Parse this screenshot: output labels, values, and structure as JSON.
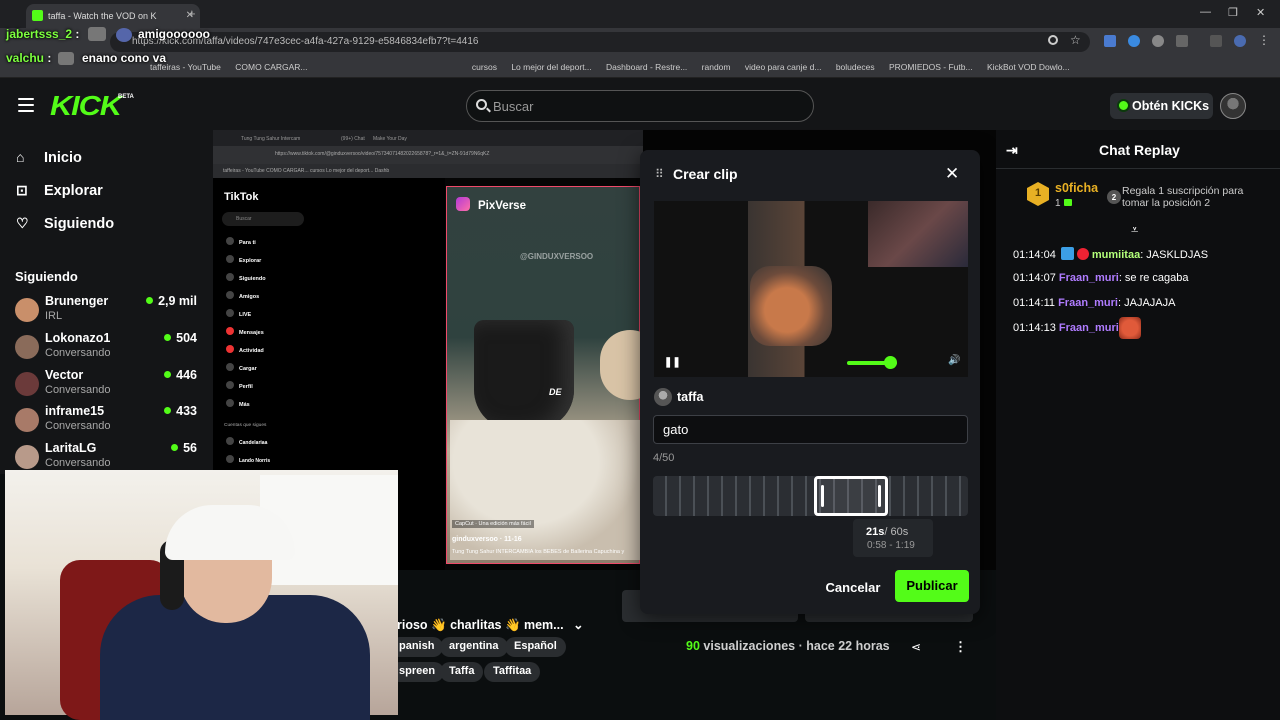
{
  "browser": {
    "tab_title": "taffa - Watch the VOD on K",
    "tab_close": "✕",
    "new_tab": "+",
    "url": "https://kick.com/taffa/videos/747e3cec-a4fa-427a-9129-e5846834efb7?t=4416",
    "window_controls": [
      "—",
      "❐",
      "✕"
    ],
    "bookmarks": [
      "taffeiras - YouTube",
      "COMO CARGAR...",
      "cursos",
      "Lo mejor del deport...",
      "Dashboard - Restre...",
      "random",
      "video para canje d...",
      "boludeces",
      "PROMIEDOS - Futb...",
      "KickBot VOD Dowlo..."
    ]
  },
  "stream_overlay_chat": [
    {
      "user": "jabertsss_2",
      "sep": " :",
      "text": "amigoooooo"
    },
    {
      "user": "valchu",
      "sep": " :",
      "text": "enano cono va"
    }
  ],
  "header": {
    "logo": "KICK",
    "beta": "BETA",
    "search_placeholder": "Buscar",
    "kicks_button": "Obtén KICKs"
  },
  "sidebar": {
    "nav": [
      {
        "label": "Inicio",
        "icon": "home-icon",
        "glyph": "⌂"
      },
      {
        "label": "Explorar",
        "icon": "explore-icon",
        "glyph": "⊡"
      },
      {
        "label": "Siguiendo",
        "icon": "heart-icon",
        "glyph": "♡"
      }
    ],
    "following_title": "Siguiendo",
    "channels": [
      {
        "name": "Brunenger",
        "category": "IRL",
        "viewers": "2,9 mil",
        "color": "#c98f6a"
      },
      {
        "name": "Lokonazo1",
        "category": "Conversando",
        "viewers": "504",
        "color": "#8a6b5a"
      },
      {
        "name": "Vector",
        "category": "Conversando",
        "viewers": "446",
        "color": "#6b3a3a"
      },
      {
        "name": "inframe15",
        "category": "Conversando",
        "viewers": "433",
        "color": "#a87a68"
      },
      {
        "name": "LaritaLG",
        "category": "Conversando",
        "viewers": "56",
        "color": "#b89a8a"
      }
    ]
  },
  "video_screen": {
    "tiktok_logo": "TikTok",
    "tiktok_search": "Buscar",
    "tiktok_nav": [
      "Para ti",
      "Explorar",
      "Siguiendo",
      "Amigos",
      "LIVE",
      "Mensajes",
      "Actividad",
      "Cargar",
      "Perfil",
      "Más"
    ],
    "tiktok_accounts": "Cuentas que sigues",
    "tiktok_account_names": [
      "Candelariaa",
      "Lando Norris"
    ],
    "pixverse": "PixVerse",
    "watermark": "@GINDUXVERSOO",
    "video_text": "DE",
    "capcut": "CapCut · Una edición más fácil",
    "video_user": "ginduxversoo · 11-16",
    "video_caption": "Tung Tung Sahur INTERCAMBIA los BEBES de Ballerina Capuchina y",
    "inner_tabs": [
      "Tung Tung Sahur Intercam",
      "(99+) Chat",
      "Make Your Day"
    ],
    "inner_url": "https://www.tiktok.com/@ginduxversoo/video/7573407148202265878?_r=1&_t=ZN-91d79N6qKZ",
    "inner_bookmarks": "taffeiras - YouTube   COMO CARGAR...   cursos   Lo mejor del deport...   Dashb"
  },
  "vod": {
    "title": "rioso 👋 charlitas 👋 mem...",
    "tags_row1": [
      "panish",
      "argentina",
      "Español"
    ],
    "tags_row2": [
      "spreen",
      "Taffa",
      "Taffitaa"
    ],
    "views_count": "90",
    "views_label": "visualizaciones",
    "ago": "hace 22 horas"
  },
  "clip_modal": {
    "title": "Crear clip",
    "username": "taffa",
    "clip_title_value": "gato",
    "char_count": "4/50",
    "duration_selected": "21s",
    "duration_max": "/ 60s",
    "range": "0:58 - 1:19",
    "trim_level": 0.67,
    "volume_level": 0.85,
    "cancel": "Cancelar",
    "publish": "Publicar"
  },
  "chat": {
    "title": "Chat Replay",
    "gift": {
      "rank": "1",
      "user": "s0ficha",
      "count": "1",
      "position": "2",
      "text": "Regala 1 suscripción para tomar la posición 2"
    },
    "messages": [
      {
        "time": "01:14:04",
        "user": "mumiitaa",
        "text": ": JASKLDJAS"
      },
      {
        "time": "01:14:07",
        "user": "Fraan_muri",
        "text": ": se re cagaba"
      },
      {
        "time": "01:14:11",
        "user": "Fraan_muri",
        "text": ": JAJAJAJA"
      },
      {
        "time": "01:14:13",
        "user": "Fraan_muri",
        "text": ":"
      }
    ]
  },
  "colors": {
    "accent": "#53fc18",
    "bg": "#0b0e0f",
    "modal": "#191b1f"
  }
}
